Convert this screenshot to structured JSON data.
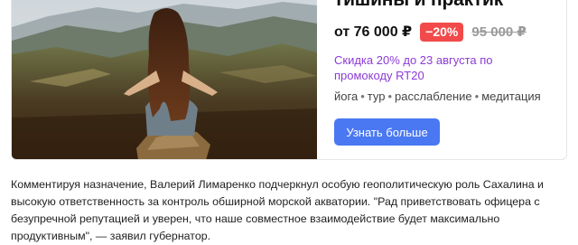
{
  "ad": {
    "title": "тишины и практик",
    "price": {
      "current": "от 76 000 ₽",
      "discount": "−20%",
      "old": "95 000 ₽"
    },
    "promo": "Скидка 20% до 23 августа по промокоду RT20",
    "tags": [
      "йога",
      "тур",
      "расслабление",
      "медитация"
    ],
    "tag_separator": "•",
    "button_label": "Узнать больше"
  },
  "article": {
    "paragraph": "Комментируя назначение, Валерий Лимаренко подчеркнул особую геополитическую роль Сахалина и высокую ответственность за контроль обширной морской акватории. \"Рад приветствовать офицера с безупречной репутацией и уверен, что наше совместное взаимодействие будет максимально продуктивным\", — заявил губернатор."
  }
}
